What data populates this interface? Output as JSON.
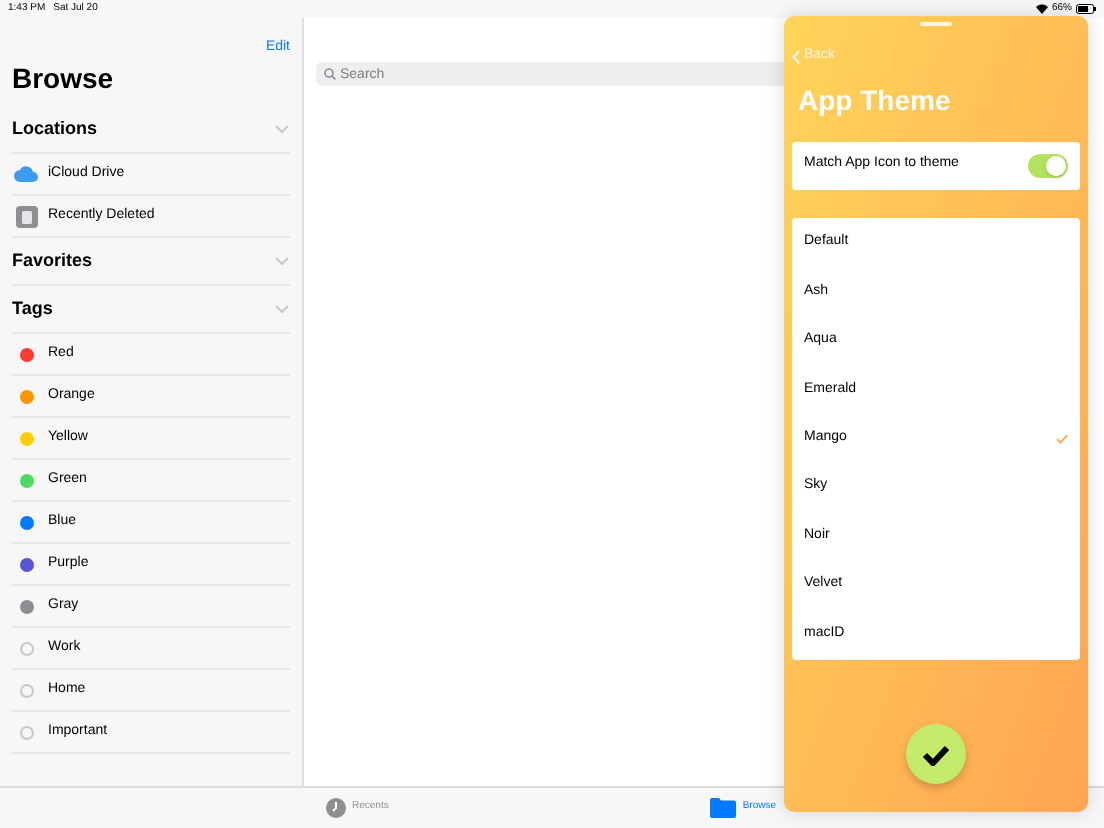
{
  "status_bar": {
    "time": "1:43 PM",
    "date": "Sat Jul 20",
    "battery": "66%"
  },
  "sidebar": {
    "edit": "Edit",
    "title": "Browse",
    "sections": [
      {
        "title": "Locations",
        "items": [
          {
            "label": "iCloud Drive",
            "kind": "cloud"
          },
          {
            "label": "Recently Deleted",
            "kind": "trash"
          }
        ]
      },
      {
        "title": "Favorites"
      },
      {
        "title": "Tags",
        "items": [
          {
            "label": "Red",
            "kind": "tag",
            "color": "#ff3b30"
          },
          {
            "label": "Orange",
            "kind": "tag",
            "color": "#ff9500"
          },
          {
            "label": "Yellow",
            "kind": "tag",
            "color": "#ffcc00"
          },
          {
            "label": "Green",
            "kind": "tag",
            "color": "#4cd964"
          },
          {
            "label": "Blue",
            "kind": "tag",
            "color": "#007aff"
          },
          {
            "label": "Purple",
            "kind": "tag",
            "color": "#5856d6"
          },
          {
            "label": "Gray",
            "kind": "tag",
            "color": "#8e8e93"
          },
          {
            "label": "Work",
            "kind": "empty"
          },
          {
            "label": "Home",
            "kind": "empty"
          },
          {
            "label": "Important",
            "kind": "empty"
          }
        ]
      }
    ]
  },
  "search": {
    "placeholder": "Search"
  },
  "tab_bar": [
    {
      "label": "Recents",
      "selected": false,
      "kind": "clock"
    },
    {
      "label": "Browse",
      "selected": true,
      "kind": "folder"
    }
  ],
  "sheet": {
    "back": "Back",
    "title": "App Theme",
    "toggle": {
      "label": "Match App Icon to theme",
      "on": true
    },
    "themes": [
      {
        "label": "Default",
        "selected": false
      },
      {
        "label": "Ash",
        "selected": false
      },
      {
        "label": "Aqua",
        "selected": false
      },
      {
        "label": "Emerald",
        "selected": false
      },
      {
        "label": "Mango",
        "selected": true
      },
      {
        "label": "Sky",
        "selected": false
      },
      {
        "label": "Noir",
        "selected": false
      },
      {
        "label": "Velvet",
        "selected": false
      },
      {
        "label": "macID",
        "selected": false
      }
    ]
  }
}
